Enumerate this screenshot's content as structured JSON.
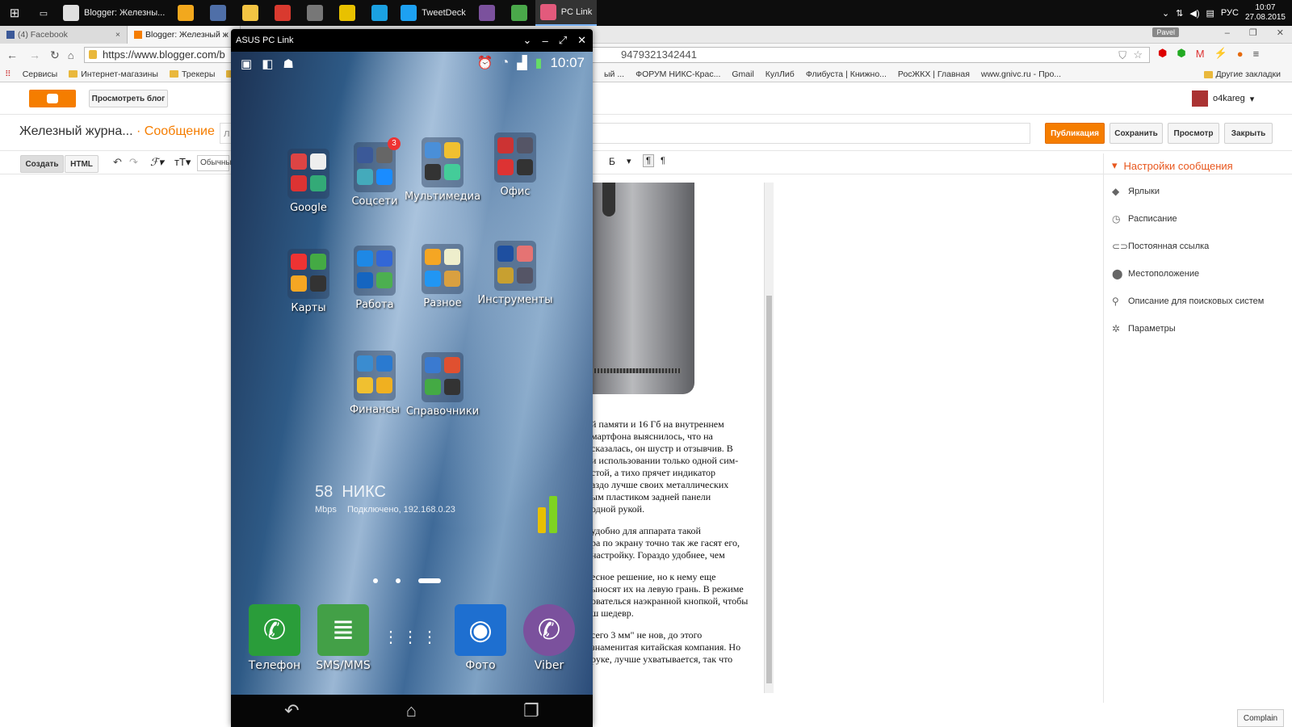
{
  "taskbar": {
    "apps": [
      {
        "label": "Blogger: Железны...",
        "color": "#e0e0e0"
      },
      {
        "label": "",
        "color": "#f2a81d"
      },
      {
        "label": "",
        "color": "#4f6fa8"
      },
      {
        "label": "",
        "color": "#f3c443"
      },
      {
        "label": "",
        "color": "#d93a2f"
      },
      {
        "label": "",
        "color": "#777"
      },
      {
        "label": "",
        "color": "#e8c100"
      },
      {
        "label": "",
        "color": "#1ba1e2"
      },
      {
        "label": "TweetDeck",
        "color": "#1da1f2"
      },
      {
        "label": "",
        "color": "#7b519d"
      },
      {
        "label": "",
        "color": "#4aa84a"
      },
      {
        "label": "PC Link",
        "color": "#e35a7c"
      }
    ],
    "lang": "РУС",
    "time": "10:07",
    "date": "27.08.2015"
  },
  "chrome": {
    "tabs": [
      {
        "label": "(4) Facebook"
      },
      {
        "label": "Blogger: Железный ж"
      }
    ],
    "user": "Pavel",
    "url": "https://www.blogger.com/b",
    "url_tail": "9479321342441",
    "bookmarks_left": [
      "Сервисы",
      "Интернет-магазины",
      "Трекеры",
      "К"
    ],
    "bookmarks_right": [
      "ый ...",
      "ФОРУМ НИКС-Крас...",
      "Gmail",
      "КулЛиб",
      "Флибуста | Книжно...",
      "РосЖКХ | Главная",
      "www.gnivc.ru - Про..."
    ],
    "other": "Другие закладки"
  },
  "blogger": {
    "view_blog": "Просмотреть блог",
    "user": "o4kareg",
    "blog_title": "Железный журна...",
    "sep": "·",
    "post": "Сообщение",
    "title_stub": "л",
    "publish": "Публикация",
    "save": "Сохранить",
    "preview": "Просмотр",
    "close": "Закрыть",
    "mode_create": "Создать",
    "mode_html": "HTML",
    "font_select": "Обычны",
    "sidebar": {
      "header": "Настройки сообщения",
      "items": [
        {
          "label": "Ярлыки",
          "icon": "tag-icon"
        },
        {
          "label": "Расписание",
          "icon": "clock-icon"
        },
        {
          "label": "Постоянная ссылка",
          "icon": "link-icon"
        },
        {
          "label": "Местоположение",
          "icon": "pin-icon"
        },
        {
          "label": "Описание для поисковых систем",
          "icon": "search-icon"
        },
        {
          "label": "Параметры",
          "icon": "gear-icon"
        }
      ]
    },
    "paragraphs": [
      [
        "й памяти и 16 Гб на внутреннем",
        "мартфона выяснилось, что на",
        "сказалась, он шустр и отзывчив. В",
        "и использовании только одной сим-",
        "стой, а тихо прячет индикатор",
        "аздо лучше своих металлических",
        "ым пластиком задней панели",
        "одной рукой."
      ],
      [
        "удобно для аппарата такой",
        "ра по экрану точно так же гасят его,",
        "настройку. Гораздо удобнее, чем"
      ],
      [
        "есное решение, но к нему еще",
        "ыносят их на левую грань. В режиме",
        "ователься наэкранной кнопкой, чтобы",
        "ш шедевр."
      ],
      [
        "сего 3 мм\" не нов, до этого",
        "знаменитая китайская компания. Но",
        "руке, лучше ухватывается, так что"
      ]
    ],
    "complain": "Complain"
  },
  "phone": {
    "window_title": "ASUS PC Link",
    "clock": "10:07",
    "folders": [
      {
        "label": "Google",
        "colors": [
          "#d44",
          "#eee",
          "#d33",
          "#3a7"
        ]
      },
      {
        "label": "Соцсети",
        "colors": [
          "#3b5998",
          "#666",
          "#4ab",
          "#1a8cff"
        ],
        "badge": "3"
      },
      {
        "label": "Мультимедиа",
        "colors": [
          "#4a8fd8",
          "#f0c030",
          "#333",
          "#4c9"
        ]
      },
      {
        "label": "Офис",
        "colors": [
          "#c33",
          "#556",
          "#d33",
          "#333"
        ]
      },
      {
        "label": "Карты",
        "colors": [
          "#e33",
          "#4a4",
          "#f5a623",
          "#333"
        ]
      },
      {
        "label": "Работа",
        "colors": [
          "#1e88e5",
          "#3367d6",
          "#1565c0",
          "#4caf50"
        ]
      },
      {
        "label": "Разное",
        "colors": [
          "#f5a623",
          "#eec",
          "#2196f3",
          "#d9a040"
        ]
      },
      {
        "label": "Инструменты",
        "colors": [
          "#1e4fa0",
          "#e57373",
          "#c8a030",
          "#556"
        ]
      },
      {
        "label": "Финансы",
        "colors": [
          "#3a8cd0",
          "#2a7ad0",
          "#f0c030",
          "#f0b020"
        ]
      },
      {
        "label": "Справочники",
        "colors": [
          "#3a7ad0",
          "#e05030",
          "#4a4",
          "#333"
        ]
      }
    ],
    "net_speed": "58",
    "net_unit": "Mbps",
    "net_name": "НИКС",
    "net_status": "Подключено, 192.168.0.23",
    "dock": [
      {
        "label": "Телефон",
        "color": "#2a9d3a",
        "icon": "phone-icon",
        "glyph": "✆"
      },
      {
        "label": "SMS/MMS",
        "color": "#43a047",
        "icon": "message-icon",
        "glyph": "≣"
      },
      {
        "label": "",
        "color": "transparent",
        "icon": "apps-grid-icon",
        "glyph": "⋮⋮⋮"
      },
      {
        "label": "Фото",
        "color": "#1e6fd0",
        "icon": "camera-icon",
        "glyph": "◉"
      },
      {
        "label": "Viber",
        "color": "#7b519d",
        "icon": "viber-icon",
        "glyph": "✆"
      }
    ]
  }
}
